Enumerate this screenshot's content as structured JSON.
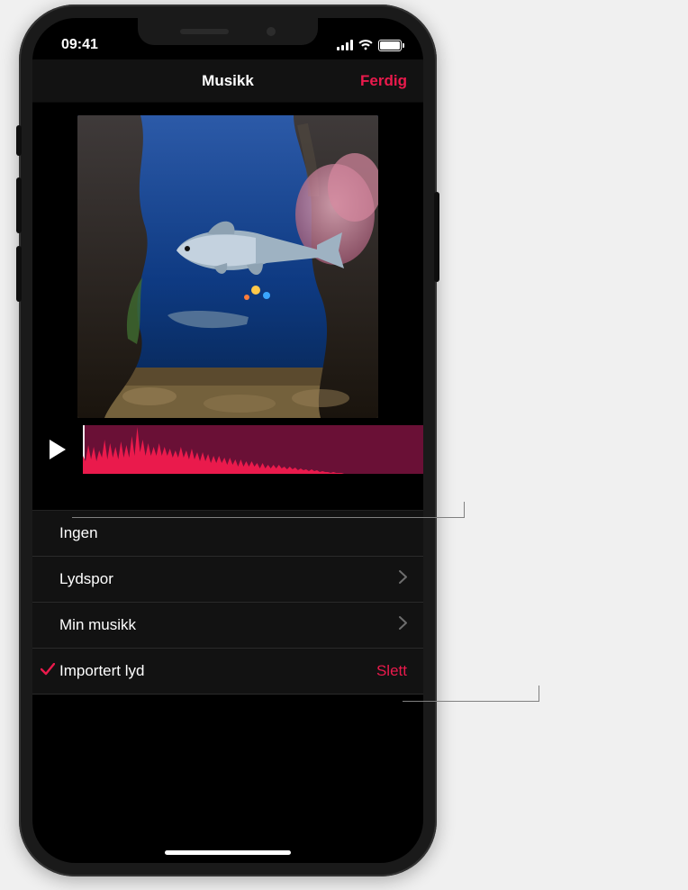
{
  "status": {
    "time": "09:41"
  },
  "nav": {
    "title": "Musikk",
    "done": "Ferdig"
  },
  "menu": {
    "none": "Ingen",
    "soundtracks": "Lydspor",
    "my_music": "Min musikk",
    "imported": "Importert lyd",
    "delete": "Slett"
  },
  "accent_color": "#ea1a4c"
}
